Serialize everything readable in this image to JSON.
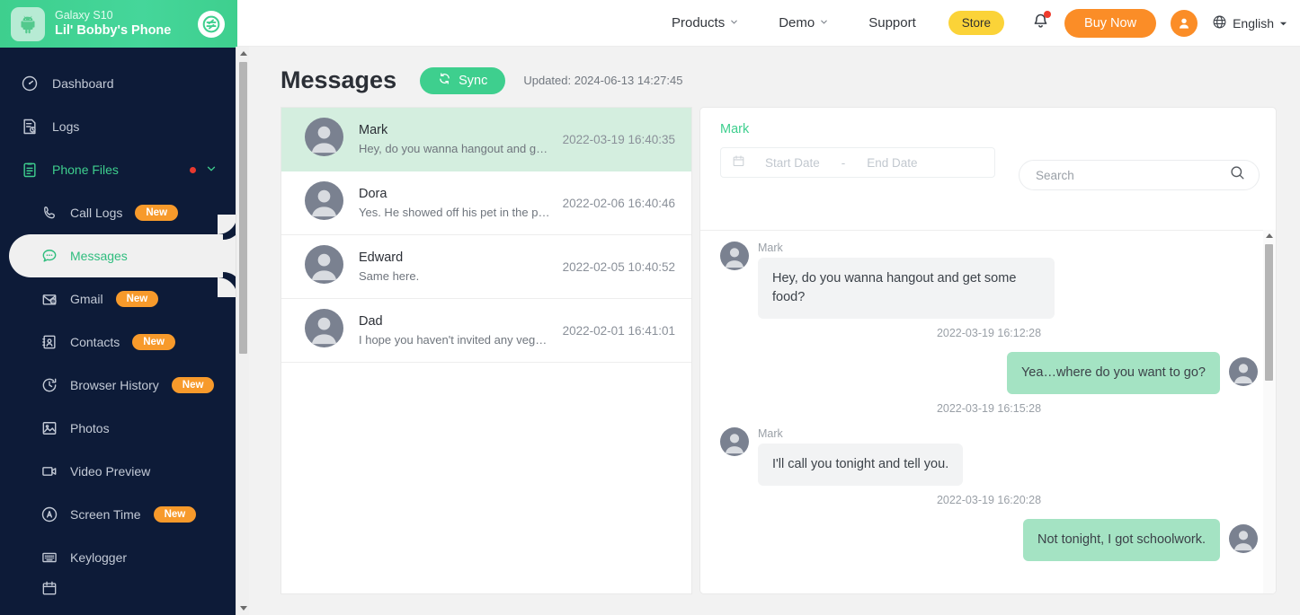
{
  "sidebar": {
    "device": {
      "model": "Galaxy S10",
      "name": "Lil' Bobby's Phone",
      "device_icon": "android-icon",
      "switch_icon": "switch-device-icon"
    },
    "items": [
      {
        "label": "Dashboard",
        "icon": "dashboard-icon",
        "badge": "",
        "level": "top"
      },
      {
        "label": "Logs",
        "icon": "logs-icon",
        "badge": "",
        "level": "top"
      },
      {
        "label": "Phone Files",
        "icon": "phone-files-icon",
        "badge": "",
        "level": "group"
      },
      {
        "label": "Call Logs",
        "icon": "phone-icon",
        "badge": "New",
        "level": "sub"
      },
      {
        "label": "Messages",
        "icon": "messages-icon",
        "badge": "",
        "level": "sub"
      },
      {
        "label": "Gmail",
        "icon": "gmail-icon",
        "badge": "New",
        "level": "sub"
      },
      {
        "label": "Contacts",
        "icon": "contacts-icon",
        "badge": "New",
        "level": "sub"
      },
      {
        "label": "Browser History",
        "icon": "history-icon",
        "badge": "New",
        "level": "sub"
      },
      {
        "label": "Photos",
        "icon": "photos-icon",
        "badge": "",
        "level": "sub"
      },
      {
        "label": "Video Preview",
        "icon": "video-icon",
        "badge": "",
        "level": "sub"
      },
      {
        "label": "Screen Time",
        "icon": "screen-time-icon",
        "badge": "New",
        "level": "sub"
      },
      {
        "label": "Keylogger",
        "icon": "keylogger-icon",
        "badge": "",
        "level": "sub"
      }
    ],
    "active_item": "Messages"
  },
  "topnav": {
    "links": [
      {
        "label": "Products",
        "caret": true
      },
      {
        "label": "Demo",
        "caret": true
      },
      {
        "label": "Support",
        "caret": false
      }
    ],
    "store_label": "Store",
    "buy_now_label": "Buy Now",
    "language": "English",
    "bell_icon": "notification-bell-icon",
    "globe_icon": "globe-icon",
    "avatar_icon": "user-avatar-icon"
  },
  "page": {
    "title": "Messages",
    "sync_label": "Sync",
    "sync_icon": "sync-icon",
    "updated_text": "Updated: 2024-06-13 14:27:45"
  },
  "conversations": [
    {
      "name": "Mark",
      "snippet": "Hey, do you wanna hangout and get…",
      "time": "2022-03-19 16:40:35",
      "selected": true
    },
    {
      "name": "Dora",
      "snippet": "Yes. He showed off his pet in the pu…",
      "time": "2022-02-06 16:40:46",
      "selected": false
    },
    {
      "name": "Edward",
      "snippet": "Same here.",
      "time": "2022-02-05 10:40:52",
      "selected": false
    },
    {
      "name": "Dad",
      "snippet": "I hope you haven't invited any veget…",
      "time": "2022-02-01 16:41:01",
      "selected": false
    }
  ],
  "chat": {
    "title": "Mark",
    "date_filter": {
      "calendar_icon": "calendar-icon",
      "start_placeholder": "Start Date",
      "separator": "-",
      "end_placeholder": "End Date"
    },
    "search": {
      "placeholder": "Search",
      "value": "",
      "icon": "search-icon"
    },
    "messages": [
      {
        "direction": "in",
        "sender": "Mark",
        "text": "Hey, do you wanna hangout and get some food?",
        "time": "2022-03-19 16:12:28"
      },
      {
        "direction": "out",
        "sender": "",
        "text": "Yea…where do you want to go?",
        "time": "2022-03-19 16:15:28"
      },
      {
        "direction": "in",
        "sender": "Mark",
        "text": "I'll call you tonight and tell you.",
        "time": "2022-03-19 16:20:28"
      },
      {
        "direction": "out",
        "sender": "",
        "text": "Not tonight, I got schoolwork.",
        "time": ""
      }
    ]
  },
  "colors": {
    "brand_green": "#3ecf8e",
    "sidebar_navy": "#0d1b38",
    "badge_orange": "#f79a2b",
    "store_yellow": "#fbd338",
    "buy_orange": "#fb8d27",
    "selected_row": "#d4eedf",
    "bubble_out": "#a4e3c3",
    "bubble_in": "#f2f3f4"
  }
}
